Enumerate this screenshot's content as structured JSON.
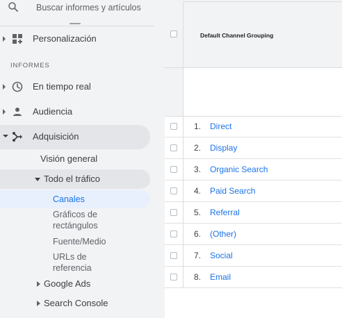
{
  "search": {
    "placeholder": "Buscar informes y artículos"
  },
  "sidebar": {
    "personalizacion": "Personalización",
    "section_header": "INFORMES",
    "tiempo_real": "En tiempo real",
    "audiencia": "Audiencia",
    "adquisicion": "Adquisición",
    "vision_general": "Visión general",
    "todo_trafico": "Todo el tráfico",
    "canales": "Canales",
    "graficos_line1": "Gráficos de",
    "graficos_line2": "rectángulos",
    "fuente_medio": "Fuente/Medio",
    "urls_line1": "URLs de",
    "urls_line2": "referencia",
    "google_ads": "Google Ads",
    "search_console": "Search Console"
  },
  "table": {
    "column_header": "Default Channel Grouping",
    "rows": [
      {
        "num": "1.",
        "label": "Direct"
      },
      {
        "num": "2.",
        "label": "Display"
      },
      {
        "num": "3.",
        "label": "Organic Search"
      },
      {
        "num": "4.",
        "label": "Paid Search"
      },
      {
        "num": "5.",
        "label": "Referral"
      },
      {
        "num": "6.",
        "label": "(Other)"
      },
      {
        "num": "7.",
        "label": "Social"
      },
      {
        "num": "8.",
        "label": "Email"
      }
    ]
  },
  "colors": {
    "accent": "#1a73e8",
    "sidebar_bg": "#f1f3f4",
    "active_bg": "#e3e5e8",
    "selected_bg": "#e8f0fe"
  }
}
